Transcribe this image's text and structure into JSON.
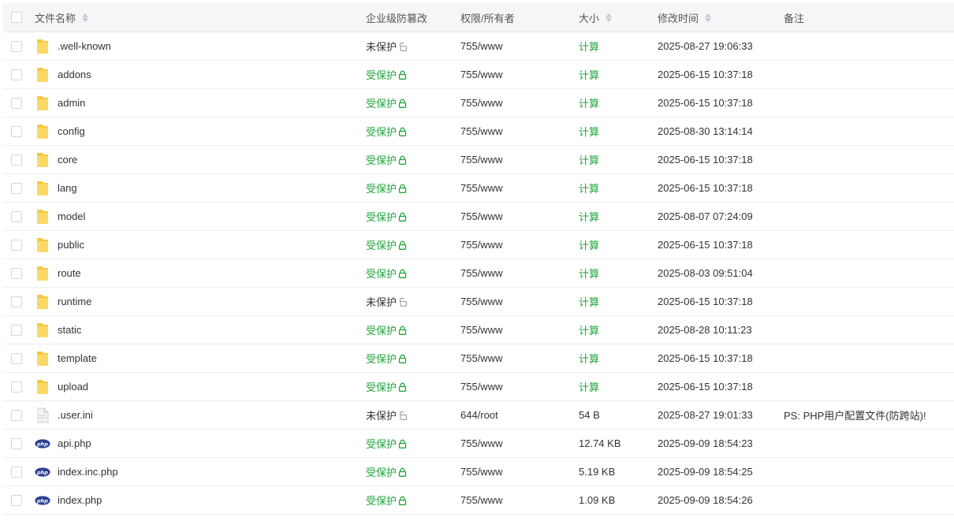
{
  "header": {
    "name": "文件名称",
    "protection": "企业级防篡改",
    "permission": "权限/所有者",
    "size": "大小",
    "mtime": "修改时间",
    "note": "备注"
  },
  "colors": {
    "accent_green": "#20a53a",
    "folder_yellow": "#f5c842",
    "php_navy": "#2c3e8f"
  },
  "rows": [
    {
      "name": ".well-known",
      "type": "folder",
      "protect": "未保护",
      "protected": false,
      "perm": "755/www",
      "size": "计算",
      "calc": true,
      "mtime": "2025-08-27 19:06:33",
      "note": ""
    },
    {
      "name": "addons",
      "type": "folder",
      "protect": "受保护",
      "protected": true,
      "perm": "755/www",
      "size": "计算",
      "calc": true,
      "mtime": "2025-06-15 10:37:18",
      "note": ""
    },
    {
      "name": "admin",
      "type": "folder",
      "protect": "受保护",
      "protected": true,
      "perm": "755/www",
      "size": "计算",
      "calc": true,
      "mtime": "2025-06-15 10:37:18",
      "note": ""
    },
    {
      "name": "config",
      "type": "folder",
      "protect": "受保护",
      "protected": true,
      "perm": "755/www",
      "size": "计算",
      "calc": true,
      "mtime": "2025-08-30 13:14:14",
      "note": ""
    },
    {
      "name": "core",
      "type": "folder",
      "protect": "受保护",
      "protected": true,
      "perm": "755/www",
      "size": "计算",
      "calc": true,
      "mtime": "2025-06-15 10:37:18",
      "note": ""
    },
    {
      "name": "lang",
      "type": "folder",
      "protect": "受保护",
      "protected": true,
      "perm": "755/www",
      "size": "计算",
      "calc": true,
      "mtime": "2025-06-15 10:37:18",
      "note": ""
    },
    {
      "name": "model",
      "type": "folder",
      "protect": "受保护",
      "protected": true,
      "perm": "755/www",
      "size": "计算",
      "calc": true,
      "mtime": "2025-08-07 07:24:09",
      "note": ""
    },
    {
      "name": "public",
      "type": "folder",
      "protect": "受保护",
      "protected": true,
      "perm": "755/www",
      "size": "计算",
      "calc": true,
      "mtime": "2025-06-15 10:37:18",
      "note": ""
    },
    {
      "name": "route",
      "type": "folder",
      "protect": "受保护",
      "protected": true,
      "perm": "755/www",
      "size": "计算",
      "calc": true,
      "mtime": "2025-08-03 09:51:04",
      "note": ""
    },
    {
      "name": "runtime",
      "type": "folder",
      "protect": "未保护",
      "protected": false,
      "perm": "755/www",
      "size": "计算",
      "calc": true,
      "mtime": "2025-06-15 10:37:18",
      "note": ""
    },
    {
      "name": "static",
      "type": "folder",
      "protect": "受保护",
      "protected": true,
      "perm": "755/www",
      "size": "计算",
      "calc": true,
      "mtime": "2025-08-28 10:11:23",
      "note": ""
    },
    {
      "name": "template",
      "type": "folder",
      "protect": "受保护",
      "protected": true,
      "perm": "755/www",
      "size": "计算",
      "calc": true,
      "mtime": "2025-06-15 10:37:18",
      "note": ""
    },
    {
      "name": "upload",
      "type": "folder",
      "protect": "受保护",
      "protected": true,
      "perm": "755/www",
      "size": "计算",
      "calc": true,
      "mtime": "2025-06-15 10:37:18",
      "note": ""
    },
    {
      "name": ".user.ini",
      "type": "file",
      "protect": "未保护",
      "protected": false,
      "perm": "644/root",
      "size": "54 B",
      "calc": false,
      "mtime": "2025-08-27 19:01:33",
      "note": "PS: PHP用户配置文件(防跨站)!"
    },
    {
      "name": "api.php",
      "type": "php",
      "protect": "受保护",
      "protected": true,
      "perm": "755/www",
      "size": "12.74 KB",
      "calc": false,
      "mtime": "2025-09-09 18:54:23",
      "note": ""
    },
    {
      "name": "index.inc.php",
      "type": "php",
      "protect": "受保护",
      "protected": true,
      "perm": "755/www",
      "size": "5.19 KB",
      "calc": false,
      "mtime": "2025-09-09 18:54:25",
      "note": ""
    },
    {
      "name": "index.php",
      "type": "php",
      "protect": "受保护",
      "protected": true,
      "perm": "755/www",
      "size": "1.09 KB",
      "calc": false,
      "mtime": "2025-09-09 18:54:26",
      "note": ""
    }
  ]
}
